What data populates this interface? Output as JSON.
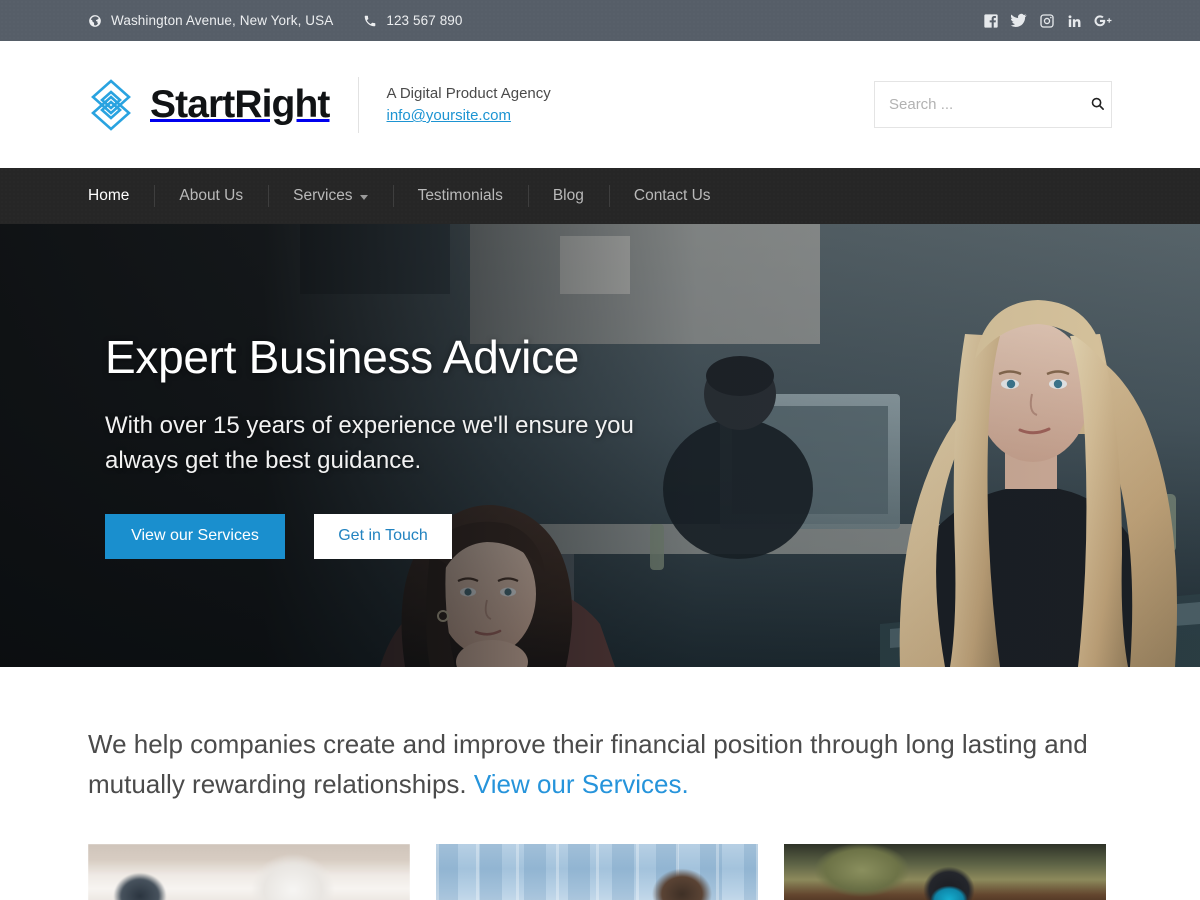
{
  "topbar": {
    "address": "Washington Avenue, New York, USA",
    "phone": "123 567 890",
    "address_icon": "globe-icon",
    "phone_icon": "phone-icon",
    "social": [
      {
        "name": "facebook-icon",
        "label": "Facebook"
      },
      {
        "name": "twitter-icon",
        "label": "Twitter"
      },
      {
        "name": "instagram-icon",
        "label": "Instagram"
      },
      {
        "name": "linkedin-icon",
        "label": "LinkedIn"
      },
      {
        "name": "googleplus-icon",
        "label": "Google Plus"
      }
    ]
  },
  "header": {
    "logo_name": "StartRight",
    "tagline": "A Digital Product Agency",
    "email": "info@yoursite.com",
    "search": {
      "placeholder": "Search ...",
      "value": "",
      "icon": "search-icon"
    }
  },
  "nav": {
    "items": [
      {
        "label": "Home",
        "active": true,
        "dropdown": false
      },
      {
        "label": "About Us",
        "active": false,
        "dropdown": false
      },
      {
        "label": "Services",
        "active": false,
        "dropdown": true
      },
      {
        "label": "Testimonials",
        "active": false,
        "dropdown": false
      },
      {
        "label": "Blog",
        "active": false,
        "dropdown": false
      },
      {
        "label": "Contact Us",
        "active": false,
        "dropdown": false
      }
    ]
  },
  "hero": {
    "title": "Expert Business Advice",
    "subtitle": "With over 15 years of experience we'll ensure you always get the best guidance.",
    "primary_button": "View our Services",
    "secondary_button": "Get in Touch",
    "image_alt": "Two women working together at an office computer"
  },
  "intro": {
    "text_before": "We help companies create and improve their financial position through long lasting and mutually rewarding relationships. ",
    "link_text": "View our Services."
  },
  "cards": [
    {
      "name": "card-desk",
      "alt": "Coffee cup on a bright office desk"
    },
    {
      "name": "card-glass",
      "alt": "Woman standing by blue glass office windows"
    },
    {
      "name": "card-phone",
      "alt": "Hand holding a smartphone with a blue screen"
    }
  ],
  "colors": {
    "topbar_bg": "#565e68",
    "nav_bg": "#262626",
    "accent_blue": "#1a8fce",
    "link_blue": "#2694db",
    "logo_blue": "#29a3e0",
    "text_dark": "#4b4b4b"
  }
}
